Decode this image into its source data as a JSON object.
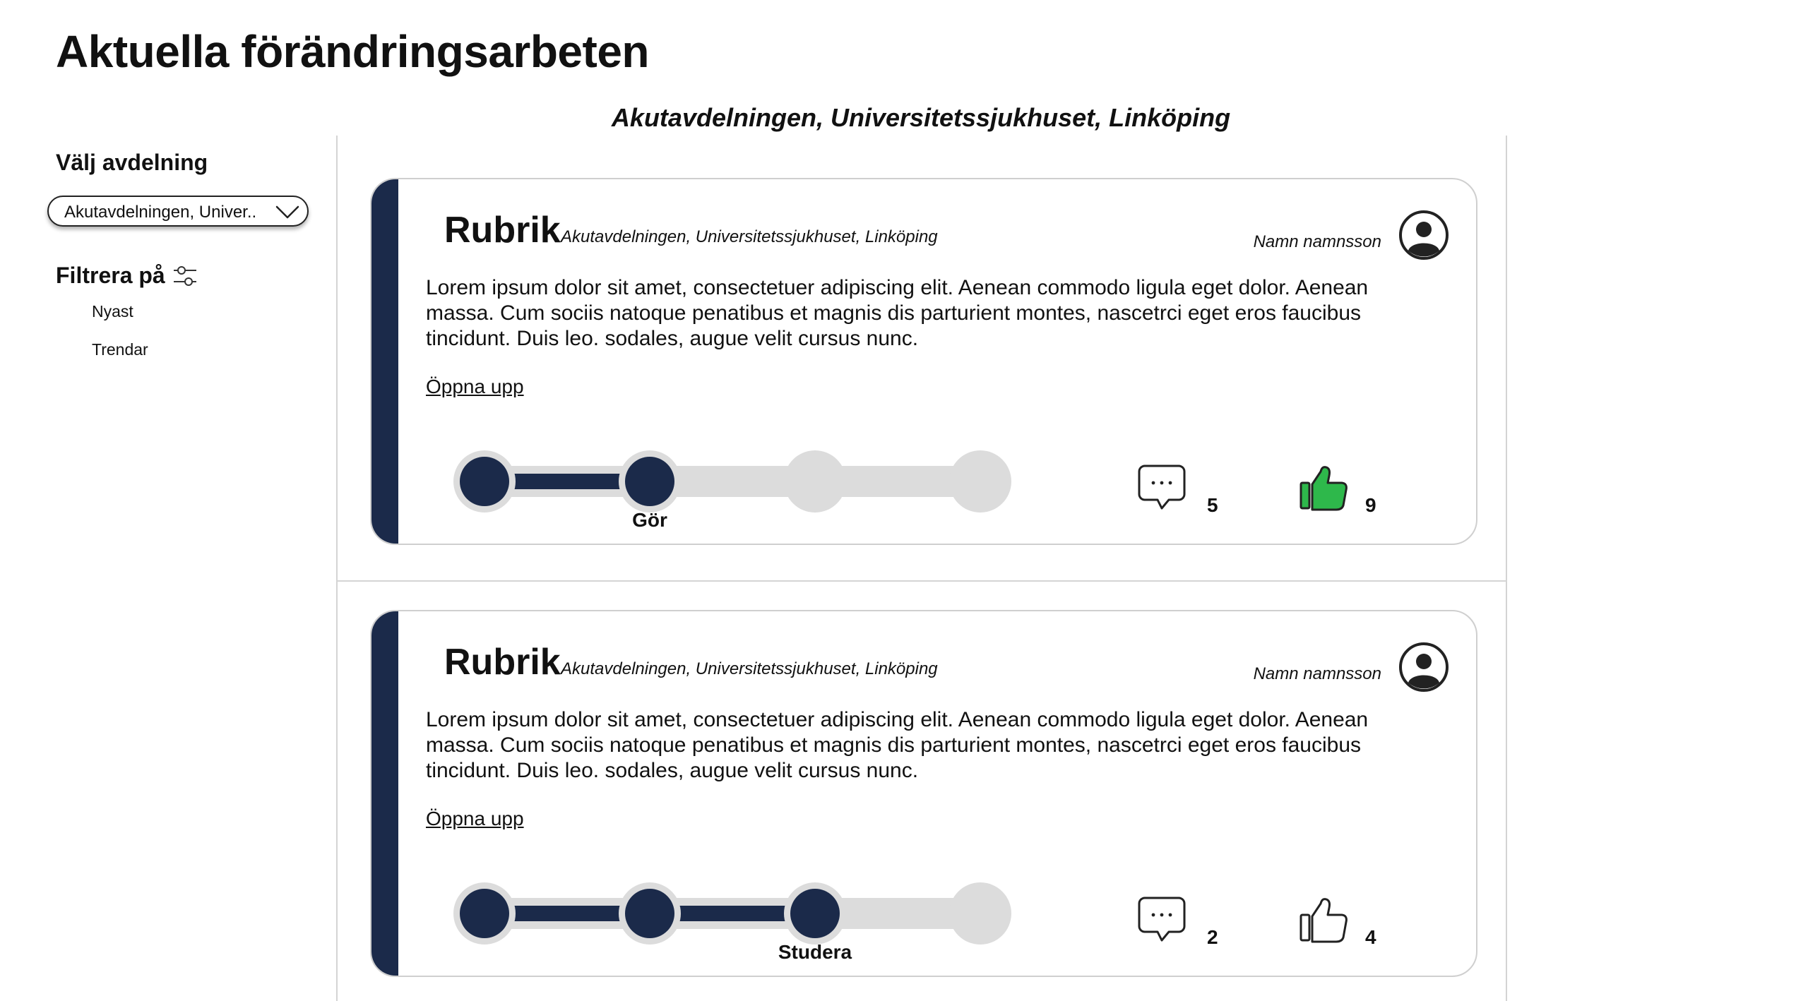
{
  "page": {
    "title": "Aktuella förändringsarbeten",
    "context_title": "Akutavdelningen, Universitetssjukhuset, Linköping"
  },
  "sidebar": {
    "choose_label": "Välj avdelning",
    "selected_department": "Akutavdelningen, Univer..",
    "filter_label": "Filtrera på",
    "filters": [
      {
        "label": "Nyast"
      },
      {
        "label": "Trendar"
      }
    ]
  },
  "colors": {
    "accent": "#1b2a4a",
    "progress_inactive": "#dcdcdc",
    "like_active": "#2eb84b"
  },
  "posts": [
    {
      "title": "Rubrik",
      "location": "Akutavdelningen, Universitetssjukhuset, Linköping",
      "author": "Namn namnsson",
      "body": "Lorem ipsum dolor sit amet, consectetuer adipiscing elit. Aenean commodo ligula eget dolor. Aenean massa. Cum sociis natoque penatibus et magnis dis parturient montes, nascetrci eget eros faucibus tincidunt. Duis leo. sodales, augue velit cursus nunc.",
      "open_link": "Öppna upp",
      "progress": {
        "total_steps": 4,
        "completed_steps": 2,
        "current_label": "Gör"
      },
      "comments": "5",
      "likes": "9",
      "liked": true
    },
    {
      "title": "Rubrik",
      "location": "Akutavdelningen, Universitetssjukhuset, Linköping",
      "author": "Namn namnsson",
      "body": "Lorem ipsum dolor sit amet, consectetuer adipiscing elit. Aenean commodo ligula eget dolor. Aenean massa. Cum sociis natoque penatibus et magnis dis parturient montes, nascetrci eget eros faucibus tincidunt. Duis leo. sodales, augue velit cursus nunc.",
      "open_link": "Öppna upp",
      "progress": {
        "total_steps": 4,
        "completed_steps": 3,
        "current_label": "Studera"
      },
      "comments": "2",
      "likes": "4",
      "liked": false
    }
  ]
}
